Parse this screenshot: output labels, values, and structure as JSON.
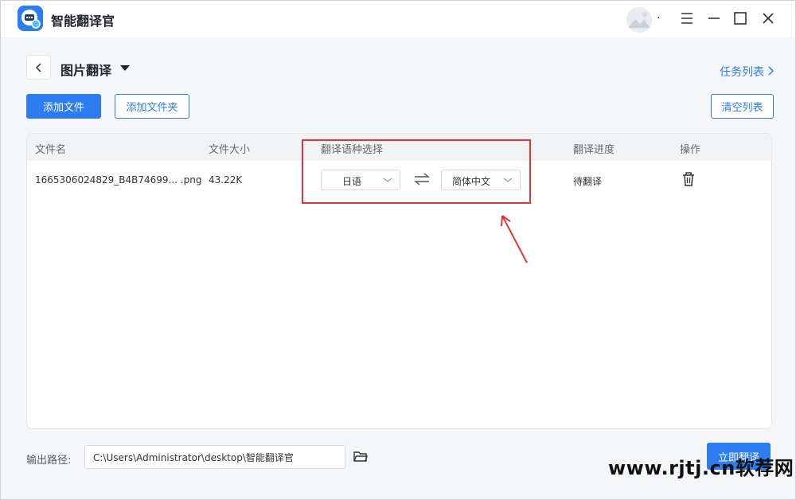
{
  "titlebar": {
    "app_name": "智能翻译官",
    "avatar_suffix": ".",
    "menu_icon": "hamburger-icon",
    "minimize_icon": "minimize-icon",
    "maximize_icon": "maximize-icon",
    "close_icon": "close-icon"
  },
  "header": {
    "page_title": "图片翻译",
    "task_list_link": "任务列表"
  },
  "toolbar": {
    "add_file": "添加文件",
    "add_folder": "添加文件夹",
    "clear_list": "清空列表"
  },
  "table": {
    "columns": [
      "文件名",
      "文件大小",
      "翻译语种选择",
      "翻译进度",
      "操作"
    ],
    "rows": [
      {
        "filename": "1665306024829_B4B74699...  .png",
        "size": "43.22K",
        "source_lang": "日语",
        "target_lang": "简体中文",
        "progress": "待翻译"
      }
    ]
  },
  "footer": {
    "output_label": "输出路径:",
    "output_path": "C:\\Users\\Administrator\\desktop\\智能翻译官",
    "translate_button": "立即翻译"
  },
  "watermark": "www.rjtj.cn软荐网",
  "colors": {
    "accent": "#2d7cf0",
    "annotation": "#e8333c"
  }
}
